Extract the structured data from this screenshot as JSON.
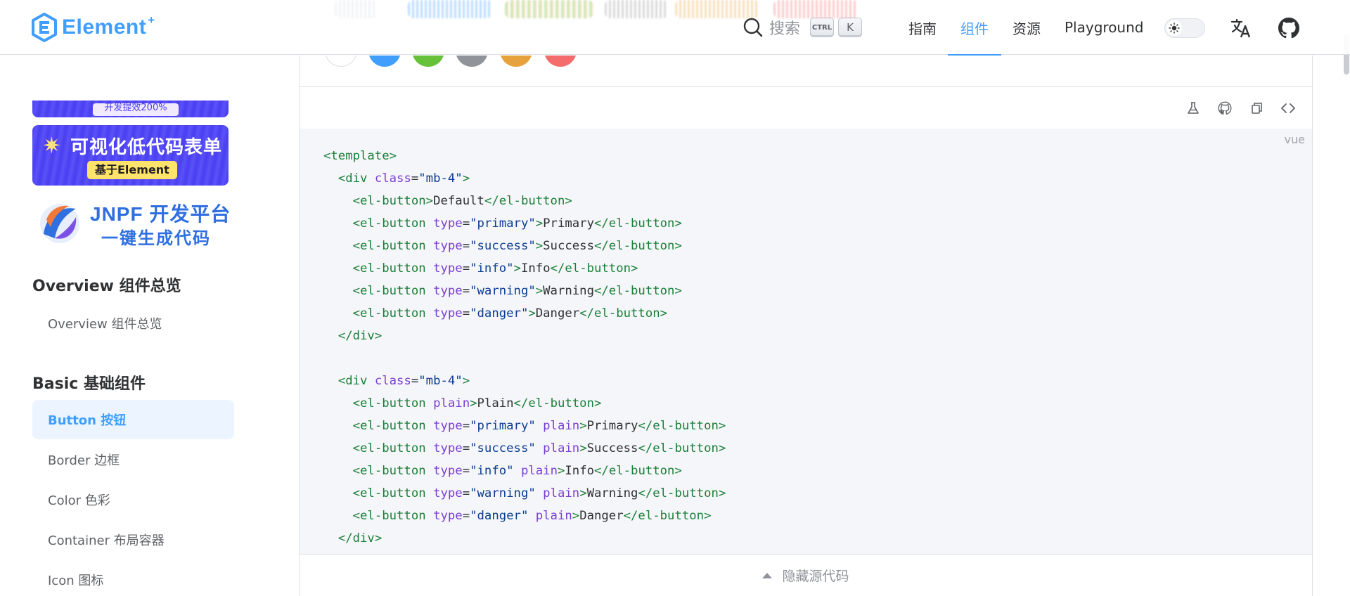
{
  "header": {
    "logo_text": "Element",
    "logo_sup": "+",
    "search_label": "搜索",
    "kbd_ctrl": "CTRL",
    "kbd_k": "K",
    "nav": [
      {
        "label": "指南",
        "active": false
      },
      {
        "label": "组件",
        "active": true
      },
      {
        "label": "资源",
        "active": false
      },
      {
        "label": "Playground",
        "active": false
      }
    ],
    "accent": "#409eff"
  },
  "sidebar": {
    "ad_strip_text": "开发提效200%",
    "ad_form_title": "可视化低代码表单",
    "ad_form_badge": "基于Element",
    "ad_jnpf_title": "JNPF 开发平台",
    "ad_jnpf_sub": "一键生成代码",
    "groups": [
      {
        "title": "Overview 组件总览",
        "items": [
          {
            "label": "Overview 组件总览",
            "active": false
          }
        ]
      },
      {
        "title": "Basic 基础组件",
        "items": [
          {
            "label": "Button 按钮",
            "active": true
          },
          {
            "label": "Border 边框",
            "active": false
          },
          {
            "label": "Color 色彩",
            "active": false
          },
          {
            "label": "Container 布局容器",
            "active": false
          },
          {
            "label": "Icon 图标",
            "active": false
          }
        ]
      }
    ]
  },
  "code": {
    "lang": "vue",
    "lines": [
      [
        [
          "tag",
          "<template>"
        ]
      ],
      [
        [
          "txt",
          "  "
        ],
        [
          "tag",
          "<div"
        ],
        [
          "txt",
          " "
        ],
        [
          "attr",
          "class"
        ],
        [
          "txt",
          "="
        ],
        [
          "val",
          "\"mb-4\""
        ],
        [
          "tag",
          ">"
        ]
      ],
      [
        [
          "txt",
          "    "
        ],
        [
          "tag",
          "<el-button>"
        ],
        [
          "txt",
          "Default"
        ],
        [
          "tag",
          "</el-button>"
        ]
      ],
      [
        [
          "txt",
          "    "
        ],
        [
          "tag",
          "<el-button"
        ],
        [
          "txt",
          " "
        ],
        [
          "attr",
          "type"
        ],
        [
          "txt",
          "="
        ],
        [
          "val",
          "\"primary\""
        ],
        [
          "tag",
          ">"
        ],
        [
          "txt",
          "Primary"
        ],
        [
          "tag",
          "</el-button>"
        ]
      ],
      [
        [
          "txt",
          "    "
        ],
        [
          "tag",
          "<el-button"
        ],
        [
          "txt",
          " "
        ],
        [
          "attr",
          "type"
        ],
        [
          "txt",
          "="
        ],
        [
          "val",
          "\"success\""
        ],
        [
          "tag",
          ">"
        ],
        [
          "txt",
          "Success"
        ],
        [
          "tag",
          "</el-button>"
        ]
      ],
      [
        [
          "txt",
          "    "
        ],
        [
          "tag",
          "<el-button"
        ],
        [
          "txt",
          " "
        ],
        [
          "attr",
          "type"
        ],
        [
          "txt",
          "="
        ],
        [
          "val",
          "\"info\""
        ],
        [
          "tag",
          ">"
        ],
        [
          "txt",
          "Info"
        ],
        [
          "tag",
          "</el-button>"
        ]
      ],
      [
        [
          "txt",
          "    "
        ],
        [
          "tag",
          "<el-button"
        ],
        [
          "txt",
          " "
        ],
        [
          "attr",
          "type"
        ],
        [
          "txt",
          "="
        ],
        [
          "val",
          "\"warning\""
        ],
        [
          "tag",
          ">"
        ],
        [
          "txt",
          "Warning"
        ],
        [
          "tag",
          "</el-button>"
        ]
      ],
      [
        [
          "txt",
          "    "
        ],
        [
          "tag",
          "<el-button"
        ],
        [
          "txt",
          " "
        ],
        [
          "attr",
          "type"
        ],
        [
          "txt",
          "="
        ],
        [
          "val",
          "\"danger\""
        ],
        [
          "tag",
          ">"
        ],
        [
          "txt",
          "Danger"
        ],
        [
          "tag",
          "</el-button>"
        ]
      ],
      [
        [
          "txt",
          "  "
        ],
        [
          "tag",
          "</div>"
        ]
      ],
      [
        [
          "txt",
          ""
        ]
      ],
      [
        [
          "txt",
          "  "
        ],
        [
          "tag",
          "<div"
        ],
        [
          "txt",
          " "
        ],
        [
          "attr",
          "class"
        ],
        [
          "txt",
          "="
        ],
        [
          "val",
          "\"mb-4\""
        ],
        [
          "tag",
          ">"
        ]
      ],
      [
        [
          "txt",
          "    "
        ],
        [
          "tag",
          "<el-button"
        ],
        [
          "txt",
          " "
        ],
        [
          "attr",
          "plain"
        ],
        [
          "tag",
          ">"
        ],
        [
          "txt",
          "Plain"
        ],
        [
          "tag",
          "</el-button>"
        ]
      ],
      [
        [
          "txt",
          "    "
        ],
        [
          "tag",
          "<el-button"
        ],
        [
          "txt",
          " "
        ],
        [
          "attr",
          "type"
        ],
        [
          "txt",
          "="
        ],
        [
          "val",
          "\"primary\""
        ],
        [
          "txt",
          " "
        ],
        [
          "attr",
          "plain"
        ],
        [
          "tag",
          ">"
        ],
        [
          "txt",
          "Primary"
        ],
        [
          "tag",
          "</el-button>"
        ]
      ],
      [
        [
          "txt",
          "    "
        ],
        [
          "tag",
          "<el-button"
        ],
        [
          "txt",
          " "
        ],
        [
          "attr",
          "type"
        ],
        [
          "txt",
          "="
        ],
        [
          "val",
          "\"success\""
        ],
        [
          "txt",
          " "
        ],
        [
          "attr",
          "plain"
        ],
        [
          "tag",
          ">"
        ],
        [
          "txt",
          "Success"
        ],
        [
          "tag",
          "</el-button>"
        ]
      ],
      [
        [
          "txt",
          "    "
        ],
        [
          "tag",
          "<el-button"
        ],
        [
          "txt",
          " "
        ],
        [
          "attr",
          "type"
        ],
        [
          "txt",
          "="
        ],
        [
          "val",
          "\"info\""
        ],
        [
          "txt",
          " "
        ],
        [
          "attr",
          "plain"
        ],
        [
          "tag",
          ">"
        ],
        [
          "txt",
          "Info"
        ],
        [
          "tag",
          "</el-button>"
        ]
      ],
      [
        [
          "txt",
          "    "
        ],
        [
          "tag",
          "<el-button"
        ],
        [
          "txt",
          " "
        ],
        [
          "attr",
          "type"
        ],
        [
          "txt",
          "="
        ],
        [
          "val",
          "\"warning\""
        ],
        [
          "txt",
          " "
        ],
        [
          "attr",
          "plain"
        ],
        [
          "tag",
          ">"
        ],
        [
          "txt",
          "Warning"
        ],
        [
          "tag",
          "</el-button>"
        ]
      ],
      [
        [
          "txt",
          "    "
        ],
        [
          "tag",
          "<el-button"
        ],
        [
          "txt",
          " "
        ],
        [
          "attr",
          "type"
        ],
        [
          "txt",
          "="
        ],
        [
          "val",
          "\"danger\""
        ],
        [
          "txt",
          " "
        ],
        [
          "attr",
          "plain"
        ],
        [
          "tag",
          ">"
        ],
        [
          "txt",
          "Danger"
        ],
        [
          "tag",
          "</el-button>"
        ]
      ],
      [
        [
          "txt",
          "  "
        ],
        [
          "tag",
          "</div>"
        ]
      ]
    ],
    "hide_label": "隐藏源代码"
  },
  "toolbar_icons": [
    "playground-flask-icon",
    "github-icon",
    "copy-icon",
    "view-source-icon"
  ],
  "demo_button_colors": [
    "#ffffff",
    "#409eff",
    "#67c23a",
    "#909399",
    "#e6a23c",
    "#f56c6c"
  ]
}
